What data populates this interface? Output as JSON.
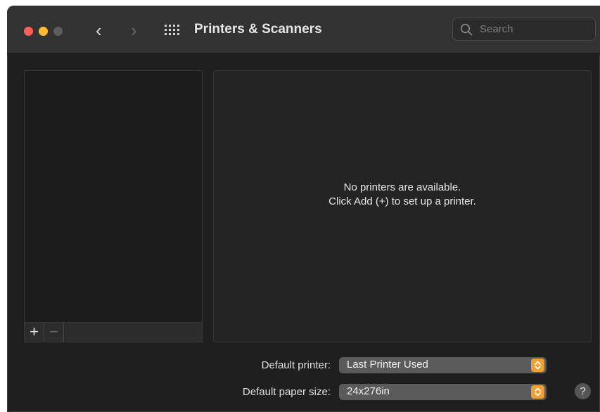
{
  "window": {
    "title": "Printers & Scanners",
    "nav": {
      "back_glyph": "‹",
      "forward_glyph": "›",
      "grid_icon": "grid-icon"
    }
  },
  "search": {
    "placeholder": "Search",
    "icon": "search-icon"
  },
  "printer_list": {
    "add_label": "+",
    "remove_label": "−"
  },
  "detail": {
    "empty_line1": "No printers are available.",
    "empty_line2": "Click Add (+) to set up a printer."
  },
  "settings": {
    "default_printer_label": "Default printer:",
    "default_printer_value": "Last Printer Used",
    "default_paper_label": "Default paper size:",
    "default_paper_value": "24x276in"
  },
  "help": {
    "label": "?"
  },
  "colors": {
    "accent": "#f0a030",
    "close": "#fe5f57",
    "minimize": "#febc2e",
    "zoom_disabled": "#5d5d5d"
  }
}
